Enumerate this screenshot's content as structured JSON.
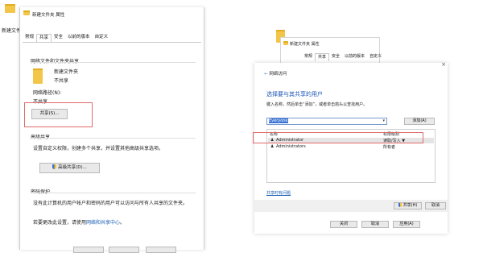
{
  "left": {
    "desktop_label": "新建文件",
    "title": "新建文件夹 属性",
    "tabs": [
      "常规",
      "共享",
      "安全",
      "以前的版本",
      "自定义"
    ],
    "net_share_title": "网络文件和文件夹共享",
    "folder_name": "新建文件夹",
    "folder_status": "不共享",
    "net_path_label": "网络路径(N):",
    "net_path_value": "不共享",
    "share_button": "共享(S)...",
    "adv_title": "高级共享",
    "adv_desc": "设置自定义权限，创建多个共享，并设置其他高级共享选项。",
    "adv_button": "高级共享(D)...",
    "pwd_title": "密码保护",
    "pwd_line1": "没有此计算机的用户帐户和密码的用户可以访问与所有人共享的文件夹。",
    "pwd_line2_prefix": "若要更改此设置，请使用",
    "pwd_link": "网络和共享中心",
    "pwd_line2_suffix": "。"
  },
  "right": {
    "title": "新建文件夹 属性",
    "tabs": [
      "常规",
      "共享",
      "安全",
      "以前的版本",
      "自定义"
    ],
    "dialog_caption": "网络访问",
    "heading": "选择要与其共享的用户",
    "instruction": "键入名称，然后单击“添加”，或者单击箭头以查找用户。",
    "input_value": "Everyone",
    "add_button": "添加(A)",
    "col_name": "名称",
    "col_perm": "权限级别",
    "rows": [
      {
        "name": "Administrator",
        "perm": "读取/写入 ▼"
      },
      {
        "name": "Administrators",
        "perm": "所有者"
      }
    ],
    "help_link": "共享时有问题",
    "share_button": "共享(H)",
    "cancel_button": "取消",
    "close_button": "关闭",
    "bottom_cancel": "取消",
    "apply_button": "应用(A)"
  }
}
